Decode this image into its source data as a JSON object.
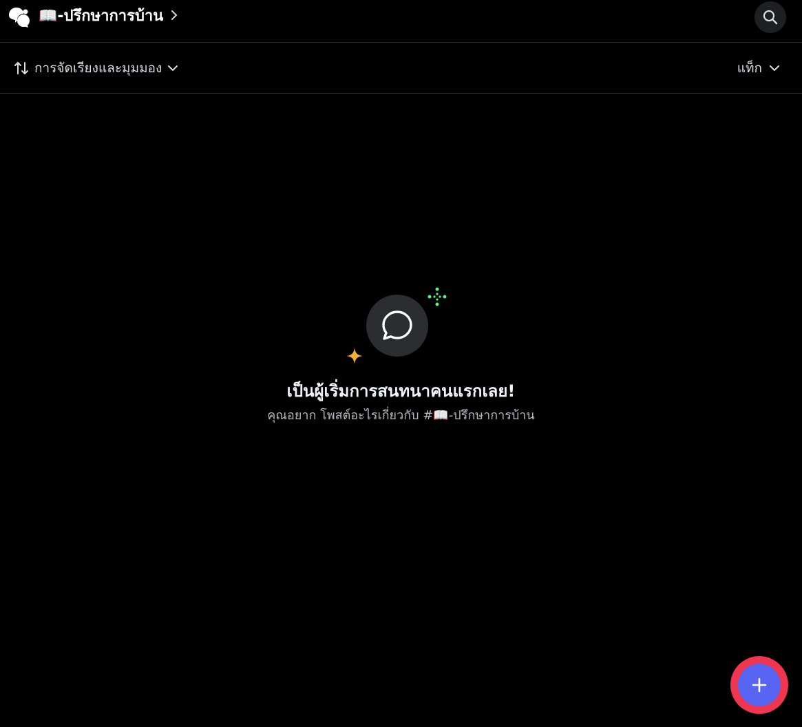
{
  "header": {
    "forum_icon": "forum-icon",
    "channel_title": "📖-ปรึกษาการบ้าน",
    "chevron_icon": "chevron-right-icon",
    "search_icon": "search-icon"
  },
  "toolbar": {
    "sort_icon": "sort-arrows-icon",
    "sort_label": "การจัดเรียงและมุมมอง",
    "tags_label": "แท็ก",
    "dropdown_icon": "chevron-down-icon"
  },
  "empty_state": {
    "illustration_icon": "chat-bubble-icon",
    "title": "เป็นผู้เริ่มการสนทนาคนแรกเลย!",
    "subtitle": "คุณอยาก โพสต์อะไรเกี่ยวกับ #📖-ปรึกษาการบ้าน"
  },
  "fab": {
    "icon": "plus-icon"
  },
  "colors": {
    "background": "#000000",
    "fab_blurple": "#5865f2",
    "fab_highlight_ring": "#f0364f",
    "sparkle_yellow": "#f0b232",
    "sparkle_green": "#57f287"
  }
}
